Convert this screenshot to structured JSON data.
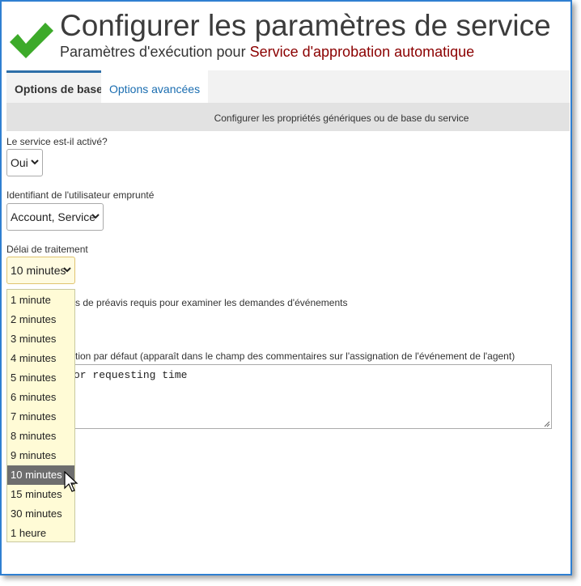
{
  "header": {
    "title": "Configurer les paramètres de service",
    "subtitle_prefix": "Paramètres d'exécution pour ",
    "service_name": "Service d'approbation automatique",
    "icon": "checkmark-icon",
    "accent": "#3daa2a"
  },
  "tabs": [
    {
      "label": "Options de base",
      "active": true
    },
    {
      "label": "Options avancées",
      "active": false
    }
  ],
  "band_text": "Configurer les propriétés génériques ou de base du service",
  "fields": {
    "enabled": {
      "label": "Le service est-il activé?",
      "value": "Oui"
    },
    "user": {
      "label": "Identifiant de l'utilisateur emprunté",
      "value": "Account, Service"
    },
    "delay": {
      "label": "Délai de traitement",
      "value": "10 minutes"
    },
    "notice_label_partial": "s de préavis requis pour examiner les demandes d'événements",
    "comment_label_partial": "tion par défaut (apparaît dans le champ des commentaires sur l'assignation de l'événement de l'agent)",
    "comment_value_partial": "or requesting time"
  },
  "dropdown": {
    "options": [
      "1 minute",
      "2 minutes",
      "3 minutes",
      "4 minutes",
      "5 minutes",
      "6 minutes",
      "7 minutes",
      "8 minutes",
      "9 minutes",
      "10 minutes",
      "15 minutes",
      "30 minutes",
      "1 heure"
    ],
    "selected_index": 9
  }
}
